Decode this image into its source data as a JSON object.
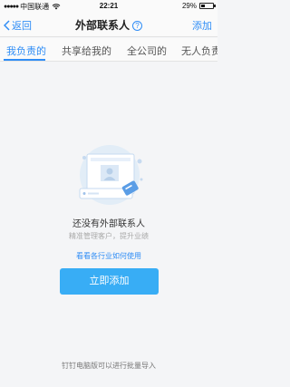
{
  "status": {
    "signal_dots": "●●●●●",
    "carrier": "中国联通",
    "time": "22:21",
    "battery": "29%"
  },
  "nav": {
    "back_label": "返回",
    "title": "外部联系人",
    "help_icon": "?",
    "add_label": "添加"
  },
  "tabs": [
    "我负责的",
    "共享给我的",
    "全公司的",
    "无人负责"
  ],
  "empty": {
    "title": "还没有外部联系人",
    "subtitle": "精准管理客户，提升业绩",
    "guide_link": "看看各行业如何使用",
    "add_button": "立即添加"
  },
  "footer": "钉钉电脑版可以进行批量导入",
  "colors": {
    "accent": "#2f8df6",
    "button": "#38adf5"
  }
}
